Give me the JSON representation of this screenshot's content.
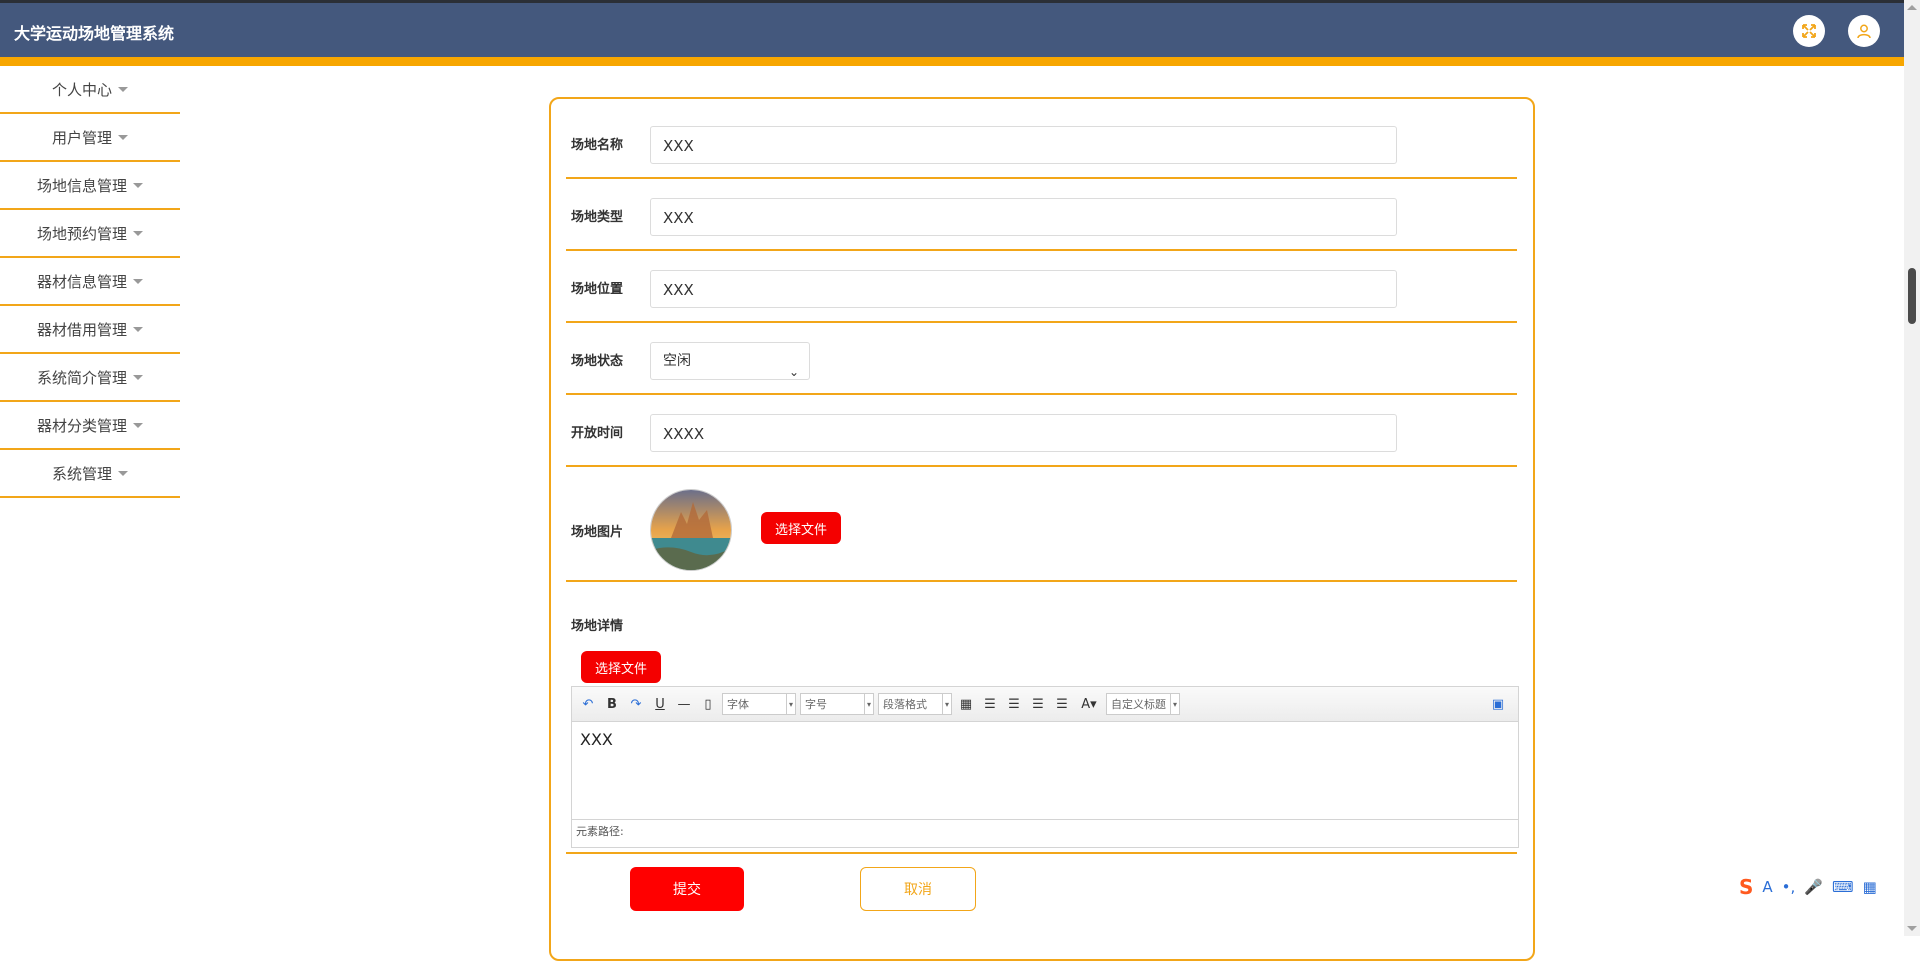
{
  "header": {
    "title": "大学运动场地管理系统",
    "icons": [
      "fullscreen-icon",
      "user-icon"
    ]
  },
  "sidebar": {
    "items": [
      {
        "label": "个人中心"
      },
      {
        "label": "用户管理"
      },
      {
        "label": "场地信息管理"
      },
      {
        "label": "场地预约管理"
      },
      {
        "label": "器材信息管理"
      },
      {
        "label": "器材借用管理"
      },
      {
        "label": "系统简介管理"
      },
      {
        "label": "器材分类管理"
      },
      {
        "label": "系统管理"
      }
    ]
  },
  "form": {
    "name": {
      "label": "场地名称",
      "value": "XXX"
    },
    "type": {
      "label": "场地类型",
      "value": "XXX"
    },
    "location": {
      "label": "场地位置",
      "value": "XXX"
    },
    "status": {
      "label": "场地状态",
      "value": "空闲"
    },
    "open_time": {
      "label": "开放时间",
      "value": "XXXX"
    },
    "image": {
      "label": "场地图片",
      "button": "选择文件"
    },
    "detail": {
      "label": "场地详情",
      "button": "选择文件",
      "toolbar": {
        "font": "字体",
        "size": "字号",
        "paragraph": "段落格式",
        "custom_title": "自定义标题"
      },
      "content": "XXX",
      "status_path": "元素路径:"
    },
    "submit": "提交",
    "cancel": "取消"
  },
  "colors": {
    "header_bg": "#44587d",
    "accent": "#f2a619",
    "button_red": "#f40000"
  }
}
